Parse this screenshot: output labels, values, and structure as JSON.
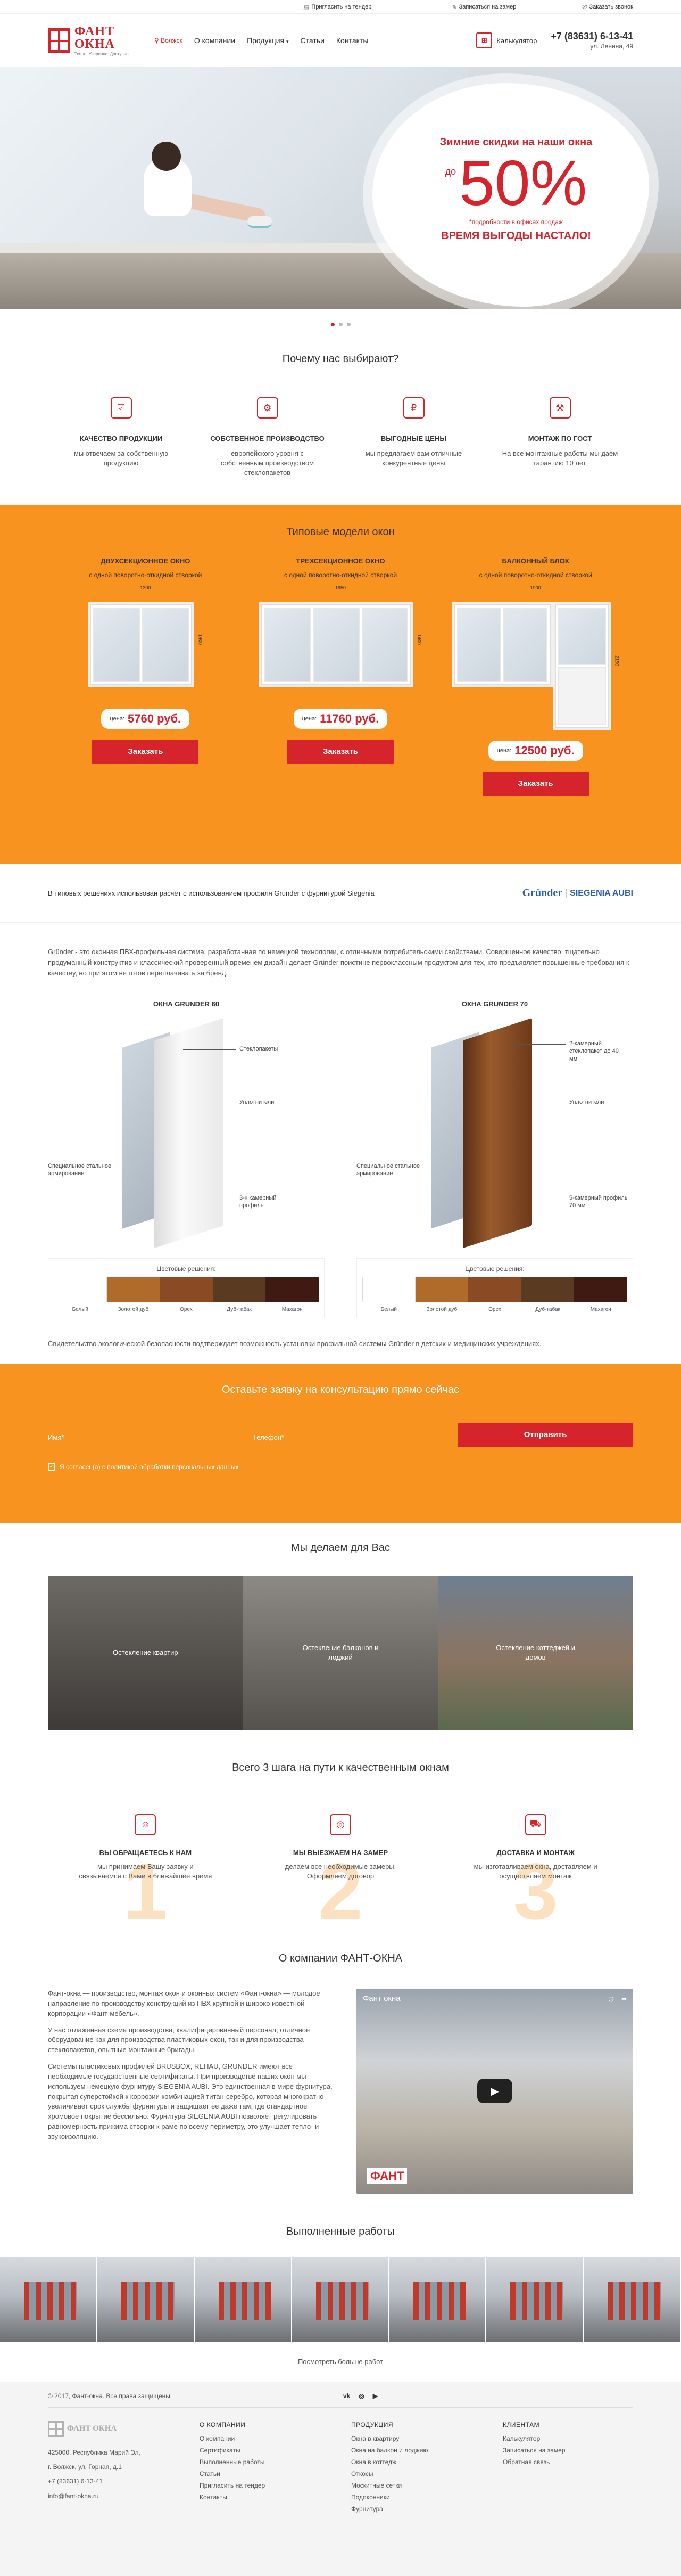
{
  "topbar": {
    "tender": "Пригласить на тендер",
    "measure": "Записаться на замер",
    "callback": "Заказать звонок"
  },
  "header": {
    "logo_title": "ФАНТ ОКНА",
    "logo_tagline": "Тепло. Уверенно. Доступно.",
    "city": "Волжск",
    "nav": [
      "О компании",
      "Продукция",
      "Статьи",
      "Контакты"
    ],
    "calculator": "Калькулятор",
    "phone": "+7 (83631) 6-13-41",
    "address": "ул. Ленина, 49"
  },
  "hero": {
    "title": "Зимние скидки на наши окна",
    "prefix": "до",
    "percent": "50%",
    "note": "*подробности в офисах продаж",
    "slogan": "ВРЕМЯ ВЫГОДЫ НАСТАЛО!",
    "slides": 3,
    "active_slide": 1
  },
  "why": {
    "title": "Почему нас выбирают?",
    "items": [
      {
        "title": "КАЧЕСТВО ПРОДУКЦИИ",
        "text": "мы отвечаем за собственную продукцию"
      },
      {
        "title": "СОБСТВЕННОЕ ПРОИЗВОДСТВО",
        "text": "европейского уровня с собственным производством стеклопакетов"
      },
      {
        "title": "ВЫГОДНЫЕ ЦЕНЫ",
        "text": "мы предлагаем вам отличные конкурентные цены"
      },
      {
        "title": "МОНТАЖ ПО ГОСТ",
        "text": "На все монтажные работы мы даем гарантию 10 лет"
      }
    ]
  },
  "models": {
    "title": "Типовые модели окон",
    "price_label": "цена:",
    "order_label": "Заказать",
    "items": [
      {
        "title": "ДВУХСЕКЦИОННОЕ ОКНО",
        "sub": "с одной поворотно-откидной створкой",
        "width": "1300",
        "height": "1400",
        "price": "5760 руб."
      },
      {
        "title": "ТРЕХСЕКЦИОННОЕ ОКНО",
        "sub": "с одной поворотно-откидной створкой",
        "width": "1950",
        "height": "1400",
        "price": "11760 руб."
      },
      {
        "title": "БАЛКОННЫЙ БЛОК",
        "sub": "с одной поворотно-откидной створкой",
        "width": "1900",
        "height": "2150",
        "price": "12500 руб."
      }
    ]
  },
  "profile": {
    "text": "В типовых решениях использован расчёт с использованием профиля Grunder с фурнитурой Siegenia",
    "brand1": "Gründer",
    "brand2": "SIEGENIA AUBI"
  },
  "grunder": {
    "lead": "Gründer - это оконная ПВХ-профильная система, разработанная по немецкой технологии, с отличными потребительскими свойствами. Совершенное качество, тщательно продуманный конструктив и классический проверенный временем дизайн делает Gründer поистине первоклассным продуктом для тех, кто предъявляет повышенные требования к качеству, но при этом не готов переплачивать за бренд.",
    "left_title": "ОКНА GRUNDER 60",
    "right_title": "ОКНА GRUNDER 70",
    "labels_left": [
      "Стеклопакеты",
      "Уплотнители",
      "Специальное стальное армирование",
      "3-х камерный профиль"
    ],
    "labels_right": [
      "2-камерный стеклопакет до 40 мм",
      "Уплотнители",
      "Специальное стальное армирование",
      "5-камерный профиль 70 мм"
    ],
    "colors_title": "Цветовые решения:",
    "colors": [
      "Белый",
      "Золотой дуб",
      "Орех",
      "Дуб-табак",
      "Махагон"
    ],
    "color_hex": [
      "#ffffff",
      "#b06a2a",
      "#8a4b24",
      "#5b3a22",
      "#3e1a12"
    ],
    "foot": "Свидетельство экологической безопасности подтверждает возможность установки профильной системы Gründer в детских и медицинских учреждениях."
  },
  "consult": {
    "title": "Оставьте заявку на консультацию прямо сейчас",
    "name_placeholder": "Имя*",
    "phone_placeholder": "Телефон*",
    "send": "Отправить",
    "agree": "Я согласен(а) с политикой обработки персональных данных"
  },
  "wedo": {
    "title": "Мы делаем для Вас",
    "items": [
      "Остекление квартир",
      "Остекление балконов и лоджий",
      "Остекление коттеджей и домов"
    ]
  },
  "steps": {
    "title": "Всего 3 шага на пути к качественным окнам",
    "items": [
      {
        "num": "1",
        "title": "ВЫ ОБРАЩАЕТЕСЬ К НАМ",
        "text": "мы принимаем Вашу заявку и связываемся с Вами в ближайшее время"
      },
      {
        "num": "2",
        "title": "МЫ ВЫЕЗЖАЕМ НА ЗАМЕР",
        "text": "делаем все необходимые замеры. Оформляем договор"
      },
      {
        "num": "3",
        "title": "ДОСТАВКА И МОНТАЖ",
        "text": "мы изготавливаем окна, доставляем и осуществляем монтаж"
      }
    ]
  },
  "about": {
    "title": "О компании ФАНТ-ОКНА",
    "paragraphs": [
      "Фант-окна — производство, монтаж окон и оконных систем «Фант-окна» — молодое направление по производству конструкций из ПВХ крупной и широко известной корпорации «Фант-мебель».",
      "У нас отлаженная схема производства, квалифицированный персонал, отличное оборудование как для производства пластиковых окон, так и для производства стеклопакетов, опытные монтажные бригады.",
      "Системы пластиковых профилей BRUSBOX, REHAU, GRUNDER имеют все необходимые государственные сертификаты. При производстве наших окон мы используем немецкую фурнитуру SIEGENIA AUBI. Это единственная в мире фурнитура, покрытая суперстойкой к коррозии комбинацией титан-серебро, которая многократно увеличивает срок службы фурнитуры и защищает ее даже там, где стандартное хромовое покрытие бессильно. Фурнитура SIEGENIA AUBI позволяет регулировать равномерность прижима створки к раме по всему периметру, это улучшает тепло- и звукоизоляцию."
    ],
    "video_title": "Фант окна",
    "video_brand": "ФАНТ"
  },
  "works": {
    "title": "Выполненные работы",
    "count": 7,
    "more": "Посмотреть больше работ"
  },
  "footer": {
    "copyright": "© 2017, Фант-окна. Все права защищены.",
    "social": [
      "vk",
      "ig",
      "yt"
    ],
    "logo": "ФАНТ ОКНА",
    "address_lines": [
      "425000, Республика Марий Эл,",
      "г. Волжск, ул. Горная, д.1",
      "+7 (83631) 6-13-41",
      "info@fant-okna.ru"
    ],
    "cols": [
      {
        "title": "О КОМПАНИИ",
        "items": [
          "О компании",
          "Сертификаты",
          "Выполненные работы",
          "Статьи",
          "Пригласить на тендер",
          "Контакты"
        ]
      },
      {
        "title": "ПРОДУКЦИЯ",
        "items": [
          "Окна в квартиру",
          "Окна на балкон и лоджию",
          "Окна в коттедж",
          "Откосы",
          "Москитные сетки",
          "Подоконники",
          "Фурнитура"
        ]
      },
      {
        "title": "КЛИЕНТАМ",
        "items": [
          "Калькулятор",
          "Записаться на замер",
          "Обратная связь"
        ]
      }
    ]
  }
}
